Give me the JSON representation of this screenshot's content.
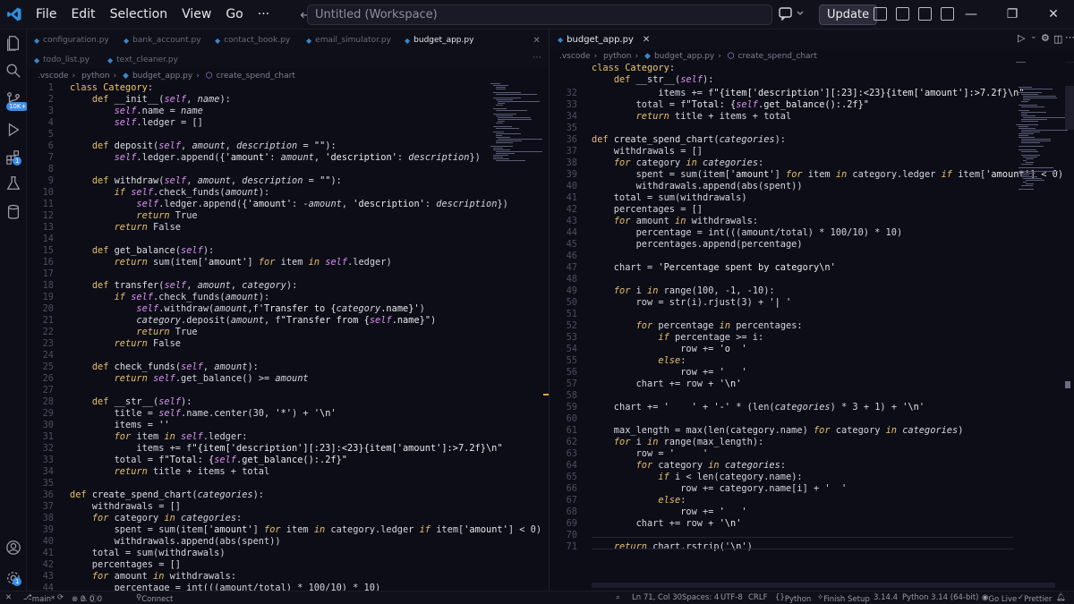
{
  "titlebar": {
    "menu": [
      "File",
      "Edit",
      "Selection",
      "View",
      "Go",
      "···"
    ],
    "search_text": "Untitled (Workspace)",
    "update_label": "Update",
    "back_icon": "arrow-left-icon",
    "forward_icon": "arrow-right-icon"
  },
  "activity_badges": {
    "source_control": "10K+",
    "extensions": "1",
    "accounts": "1"
  },
  "left_group": {
    "tabs_row1": [
      "configuration.py",
      "bank_account.py",
      "contact_book.py",
      "email_simulator.py",
      "budget_app.py"
    ],
    "tabs_row2": [
      "todo_list.py",
      "text_cleaner.py"
    ],
    "active_tab": "budget_app.py",
    "breadcrumb": [
      ".vscode",
      "python",
      "budget_app.py",
      "create_spend_chart"
    ]
  },
  "right_group": {
    "active_tab": "budget_app.py",
    "breadcrumb": [
      ".vscode",
      "python",
      "budget_app.py",
      "create_spend_chart"
    ],
    "sticky_1": "class Category:",
    "sticky_2": "    def __str__(self):"
  },
  "status": {
    "branch": "main*",
    "errors": "0",
    "warnings": "0",
    "info": "0",
    "connect": "Connect",
    "position": "Ln 71, Col 30",
    "spaces": "Spaces: 4",
    "encoding": "UTF-8",
    "eol": "CRLF",
    "language": "Python",
    "finish_setup": "Finish Setup",
    "version": "3.14.4",
    "interpreter": "Python 3.14 (64-bit)",
    "go_live": "Go Live",
    "prettier": "Prettier"
  },
  "code_left": [
    {
      "n": "1",
      "h": "<span class='kw2'>class</span> <span class='cls'>Category</span>:"
    },
    {
      "n": "2",
      "h": "    <span class='kw2'>def</span> <span class='fn'>__init__</span>(<span class='self'>self</span>, <span class='param'>name</span>):"
    },
    {
      "n": "3",
      "h": "        <span class='self'>self</span>.name = <span class='param'>name</span>"
    },
    {
      "n": "4",
      "h": "        <span class='self'>self</span>.ledger = []"
    },
    {
      "n": "5",
      "h": ""
    },
    {
      "n": "6",
      "h": "    <span class='kw2'>def</span> <span class='fn'>deposit</span>(<span class='self'>self</span>, <span class='param'>amount</span>, <span class='param'>description</span> = <span class='str'>\"\"</span>):"
    },
    {
      "n": "7",
      "h": "        <span class='self'>self</span>.ledger.append({<span class='str'>'amount'</span>: <span class='param'>amount</span>, <span class='str'>'description'</span>: <span class='param'>description</span>})"
    },
    {
      "n": "8",
      "h": ""
    },
    {
      "n": "9",
      "h": "    <span class='kw2'>def</span> <span class='fn'>withdraw</span>(<span class='self'>self</span>, <span class='param'>amount</span>, <span class='param'>description</span> = <span class='str'>\"\"</span>):"
    },
    {
      "n": "10",
      "h": "        <span class='kw'>if</span> <span class='self'>self</span>.check_funds(<span class='param'>amount</span>):"
    },
    {
      "n": "11",
      "h": "            <span class='self'>self</span>.ledger.append({<span class='str'>'amount'</span>: -<span class='param'>amount</span>, <span class='str'>'description'</span>: <span class='param'>description</span>})"
    },
    {
      "n": "12",
      "h": "            <span class='kw'>return</span> True"
    },
    {
      "n": "13",
      "h": "        <span class='kw'>return</span> False"
    },
    {
      "n": "14",
      "h": ""
    },
    {
      "n": "15",
      "h": "    <span class='kw2'>def</span> <span class='fn'>get_balance</span>(<span class='self'>self</span>):"
    },
    {
      "n": "16",
      "h": "        <span class='kw'>return</span> sum(item[<span class='str'>'amount'</span>] <span class='kw'>for</span> item <span class='kw'>in</span> <span class='self'>self</span>.ledger)"
    },
    {
      "n": "17",
      "h": ""
    },
    {
      "n": "18",
      "h": "    <span class='kw2'>def</span> <span class='fn'>transfer</span>(<span class='self'>self</span>, <span class='param'>amount</span>, <span class='param'>category</span>):"
    },
    {
      "n": "19",
      "h": "        <span class='kw'>if</span> <span class='self'>self</span>.check_funds(<span class='param'>amount</span>):"
    },
    {
      "n": "20",
      "h": "            <span class='self'>self</span>.withdraw(<span class='param'>amount</span>,f<span class='str'>'Transfer to {<span class=\"param\">category</span>.name}'</span>)"
    },
    {
      "n": "21",
      "h": "            <span class='param'>category</span>.deposit(<span class='param'>amount</span>, f<span class='str'>\"Transfer from {<span class=\"self\">self</span>.name}\"</span>)"
    },
    {
      "n": "22",
      "h": "            <span class='kw'>return</span> True"
    },
    {
      "n": "23",
      "h": "        <span class='kw'>return</span> False"
    },
    {
      "n": "24",
      "h": ""
    },
    {
      "n": "25",
      "h": "    <span class='kw2'>def</span> <span class='fn'>check_funds</span>(<span class='self'>self</span>, <span class='param'>amount</span>):"
    },
    {
      "n": "26",
      "h": "        <span class='kw'>return</span> <span class='self'>self</span>.get_balance() &gt;= <span class='param'>amount</span>"
    },
    {
      "n": "27",
      "h": ""
    },
    {
      "n": "28",
      "h": "    <span class='kw2'>def</span> <span class='fn'>__str__</span>(<span class='self'>self</span>):"
    },
    {
      "n": "29",
      "h": "        title = <span class='self'>self</span>.name.center(30, <span class='str'>'*'</span>) + <span class='str'>'\\n'</span>"
    },
    {
      "n": "30",
      "h": "        items = <span class='str'>''</span>"
    },
    {
      "n": "31",
      "h": "        <span class='kw'>for</span> item <span class='kw'>in</span> <span class='self'>self</span>.ledger:"
    },
    {
      "n": "32",
      "h": "            items += f<span class='str'>\"{item['description'][:23]:&lt;23}{item['amount']:&gt;7.2f}\\n\"</span>"
    },
    {
      "n": "33",
      "h": "        total = f<span class='str'>\"Total: {<span class=\"self\">self</span>.get_balance():.2f}\"</span>"
    },
    {
      "n": "34",
      "h": "        <span class='kw'>return</span> title + items + total"
    },
    {
      "n": "35",
      "h": ""
    },
    {
      "n": "36",
      "h": "<span class='kw2'>def</span> <span class='fn'>create_spend_chart</span>(<span class='param'>categories</span>):"
    },
    {
      "n": "37",
      "h": "    withdrawals = []"
    },
    {
      "n": "38",
      "h": "    <span class='kw'>for</span> category <span class='kw'>in</span> <span class='param'>categories</span>:"
    },
    {
      "n": "39",
      "h": "        spent = sum(item[<span class='str'>'amount'</span>] <span class='kw'>for</span> item <span class='kw'>in</span> category.ledger <span class='kw'>if</span> item[<span class='str'>'amount'</span>] &lt; 0)"
    },
    {
      "n": "40",
      "h": "        withdrawals.append(abs(spent))"
    },
    {
      "n": "41",
      "h": "    total = sum(withdrawals)"
    },
    {
      "n": "42",
      "h": "    percentages = []"
    },
    {
      "n": "43",
      "h": "    <span class='kw'>for</span> amount <span class='kw'>in</span> withdrawals:"
    },
    {
      "n": "44",
      "h": "        percentage = int(((amount/total) * 100/10) * 10)"
    }
  ],
  "code_right": [
    {
      "n": "32",
      "h": "            items += f<span class='str'>\"{item['description'][:23]:&lt;23}{item['amount']:&gt;7.2f}\\n\"</span>"
    },
    {
      "n": "33",
      "h": "        total = f<span class='str'>\"Total: {<span class=\"self\">self</span>.get_balance():.2f}\"</span>"
    },
    {
      "n": "34",
      "h": "        <span class='kw'>return</span> title + items + total"
    },
    {
      "n": "35",
      "h": ""
    },
    {
      "n": "36",
      "h": "<span class='kw2'>def</span> <span class='fn'>create_spend_chart</span>(<span class='param'>categories</span>):"
    },
    {
      "n": "37",
      "h": "    withdrawals = []"
    },
    {
      "n": "38",
      "h": "    <span class='kw'>for</span> category <span class='kw'>in</span> <span class='param'>categories</span>:"
    },
    {
      "n": "39",
      "h": "        spent = sum(item[<span class='str'>'amount'</span>] <span class='kw'>for</span> item <span class='kw'>in</span> category.ledger <span class='kw'>if</span> item[<span class='str'>'amount'</span>] &lt; 0)"
    },
    {
      "n": "40",
      "h": "        withdrawals.append(abs(spent))"
    },
    {
      "n": "41",
      "h": "    total = sum(withdrawals)"
    },
    {
      "n": "42",
      "h": "    percentages = []"
    },
    {
      "n": "43",
      "h": "    <span class='kw'>for</span> amount <span class='kw'>in</span> withdrawals:"
    },
    {
      "n": "44",
      "h": "        percentage = int(((amount/total) * 100/10) * 10)"
    },
    {
      "n": "45",
      "h": "        percentages.append(percentage)"
    },
    {
      "n": "46",
      "h": ""
    },
    {
      "n": "47",
      "h": "    chart = <span class='str'>'Percentage spent by category\\n'</span>"
    },
    {
      "n": "48",
      "h": ""
    },
    {
      "n": "49",
      "h": "    <span class='kw'>for</span> i <span class='kw'>in</span> range(100, -1, -10):"
    },
    {
      "n": "50",
      "h": "        row = str(i).rjust(3) + <span class='str'>'| '</span>"
    },
    {
      "n": "51",
      "h": ""
    },
    {
      "n": "52",
      "h": "        <span class='kw'>for</span> percentage <span class='kw'>in</span> percentages:"
    },
    {
      "n": "53",
      "h": "            <span class='kw'>if</span> percentage &gt;= i:"
    },
    {
      "n": "54",
      "h": "                row += <span class='str'>'o  '</span>"
    },
    {
      "n": "55",
      "h": "            <span class='kw'>else</span>:"
    },
    {
      "n": "56",
      "h": "                row += <span class='str'>'   '</span>"
    },
    {
      "n": "57",
      "h": "        chart += row + <span class='str'>'\\n'</span>"
    },
    {
      "n": "58",
      "h": ""
    },
    {
      "n": "59",
      "h": "    chart += <span class='str'>'    '</span> + <span class='str'>'-'</span> * (len(<span class='param'>categories</span>) * 3 + 1) + <span class='str'>'\\n'</span>"
    },
    {
      "n": "60",
      "h": ""
    },
    {
      "n": "61",
      "h": "    max_length = max(len(category.name) <span class='kw'>for</span> category <span class='kw'>in</span> <span class='param'>categories</span>)"
    },
    {
      "n": "62",
      "h": "    <span class='kw'>for</span> i <span class='kw'>in</span> range(max_length):"
    },
    {
      "n": "63",
      "h": "        row = <span class='str'>'     '</span>"
    },
    {
      "n": "64",
      "h": "        <span class='kw'>for</span> category <span class='kw'>in</span> <span class='param'>categories</span>:"
    },
    {
      "n": "65",
      "h": "            <span class='kw'>if</span> i &lt; len(category.name):"
    },
    {
      "n": "66",
      "h": "                row += category.name[i] + <span class='str'>'  '</span>"
    },
    {
      "n": "67",
      "h": "            <span class='kw'>else</span>:"
    },
    {
      "n": "68",
      "h": "                row += <span class='str'>'   '</span>"
    },
    {
      "n": "69",
      "h": "        chart += row + <span class='str'>'\\n'</span>"
    },
    {
      "n": "70",
      "h": ""
    },
    {
      "n": "71",
      "h": "    <span class='kw'>return</span> chart.rstrip(<span class='str'>'\\n'</span>)"
    }
  ]
}
